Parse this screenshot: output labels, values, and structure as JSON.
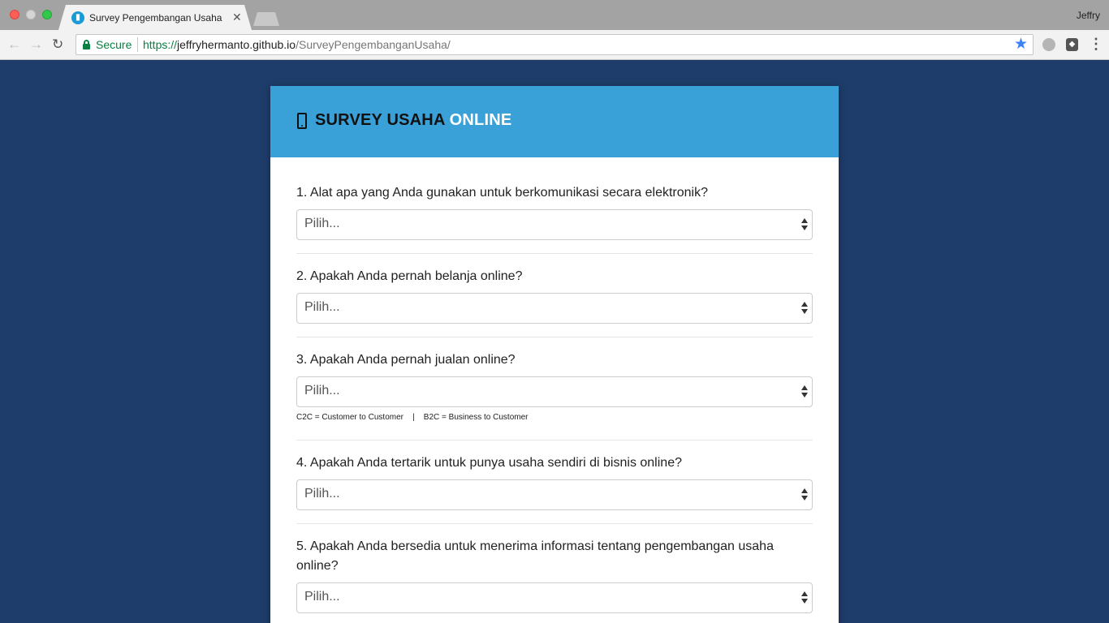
{
  "browser": {
    "tab_title": "Survey Pengembangan Usaha",
    "profile_name": "Jeffry",
    "secure_label": "Secure",
    "url_scheme": "https://",
    "url_host": "jeffryhermanto.github.io",
    "url_path": "/SurveyPengembanganUsaha/",
    "favicon_icon": "survey-app-icon",
    "bookmark_icon": "star-icon",
    "accent_color": "#3b82f6"
  },
  "page": {
    "background_color": "#1f3d6b",
    "header_color": "#3aa1d8",
    "title_main": "SURVEY USAHA",
    "title_accent": "ONLINE",
    "title_icon": "mobile-phone-icon"
  },
  "questions": [
    {
      "label": "1. Alat apa yang Anda gunakan untuk berkomunikasi secara elektronik?",
      "selected": "Pilih..."
    },
    {
      "label": "2. Apakah Anda pernah belanja online?",
      "selected": "Pilih..."
    },
    {
      "label": "3. Apakah Anda pernah jualan online?",
      "selected": "Pilih...",
      "hint": "C2C = Customer to Customer    |    B2C = Business to Customer"
    },
    {
      "label": "4. Apakah Anda tertarik untuk punya usaha sendiri di bisnis online?",
      "selected": "Pilih..."
    },
    {
      "label": "5. Apakah Anda bersedia untuk menerima informasi tentang pengembangan usaha online?",
      "selected": "Pilih..."
    }
  ]
}
